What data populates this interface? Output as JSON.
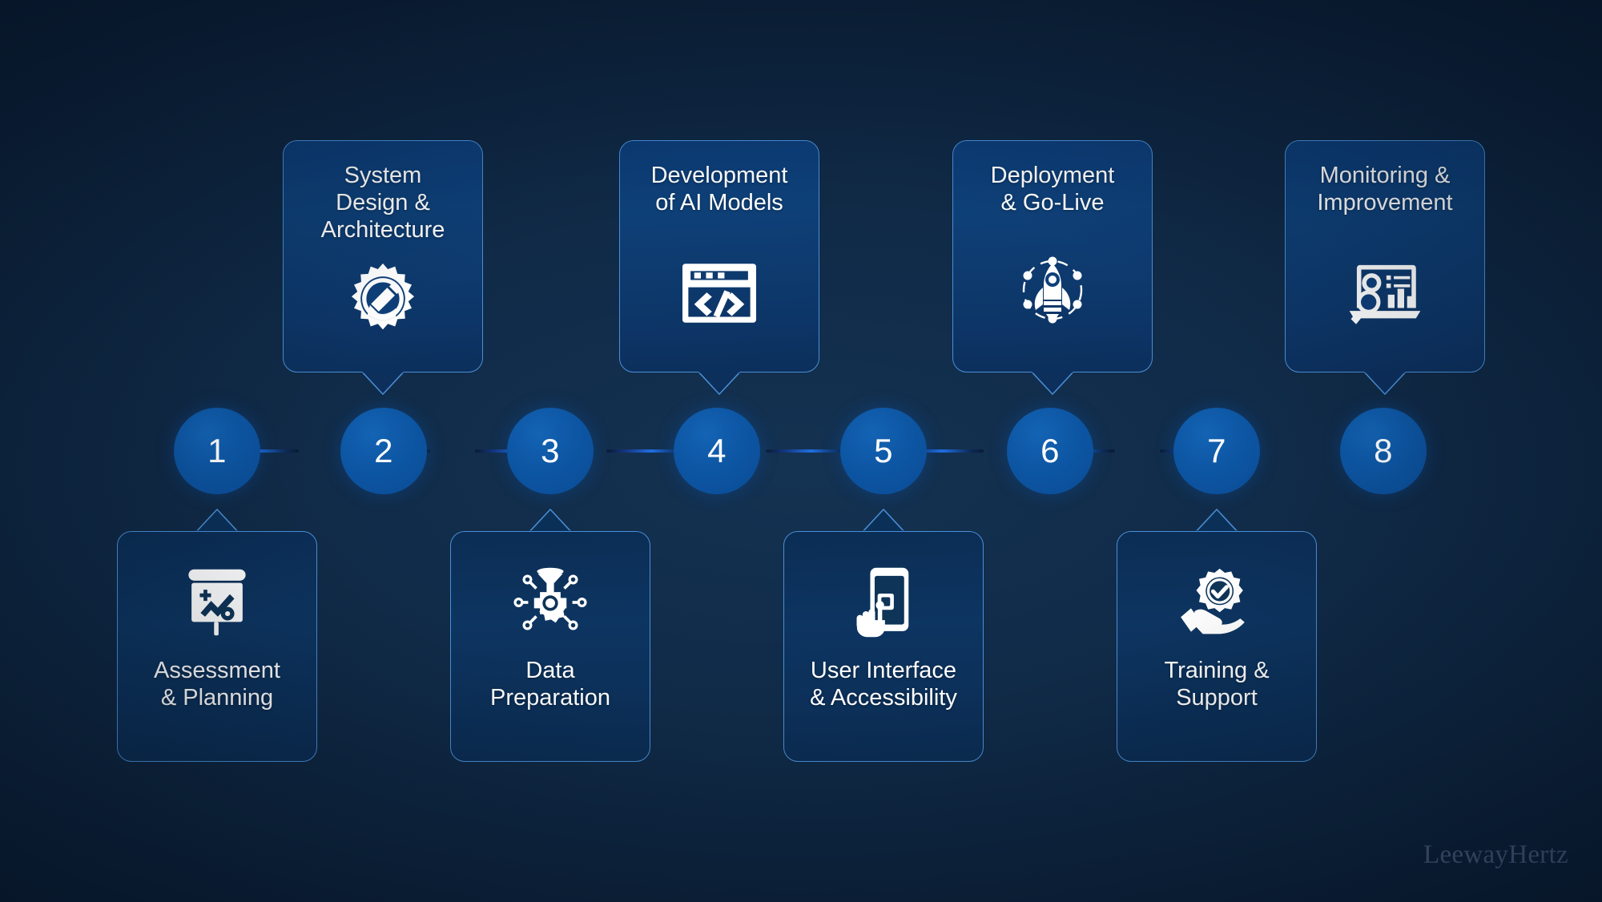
{
  "background": {
    "base_color": "#0a1d35",
    "accent_color": "#0d57a5",
    "border_color": "#4a8fd6"
  },
  "watermark": {
    "text": "LeewayHertz"
  },
  "timeline": {
    "steps": [
      {
        "number": "1",
        "label_line1": "Assessment",
        "label_line2": "& Planning",
        "icon": "presentation-chart-icon",
        "position": "bottom"
      },
      {
        "number": "2",
        "label_line1": "System",
        "label_line2": "Design &",
        "label_line3": "Architecture",
        "icon": "gear-pencil-icon",
        "position": "top"
      },
      {
        "number": "3",
        "label_line1": "Data",
        "label_line2": "Preparation",
        "icon": "funnel-gear-network-icon",
        "position": "bottom"
      },
      {
        "number": "4",
        "label_line1": "Development",
        "label_line2": "of AI Models",
        "icon": "code-window-icon",
        "position": "top"
      },
      {
        "number": "5",
        "label_line1": "User Interface",
        "label_line2": "& Accessibility",
        "icon": "phone-tap-icon",
        "position": "bottom"
      },
      {
        "number": "6",
        "label_line1": "Deployment",
        "label_line2": "& Go-Live",
        "icon": "rocket-network-icon",
        "position": "top"
      },
      {
        "number": "7",
        "label_line1": "Training &",
        "label_line2": "Support",
        "icon": "hand-gear-check-icon",
        "position": "bottom"
      },
      {
        "number": "8",
        "label_line1": "Monitoring &",
        "label_line2": "Improvement",
        "icon": "laptop-dashboard-search-icon",
        "position": "top"
      }
    ]
  }
}
